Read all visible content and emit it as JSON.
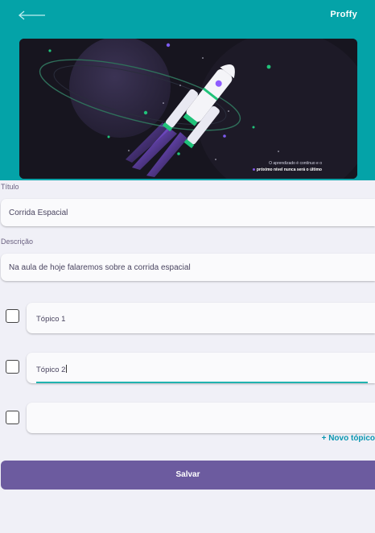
{
  "header": {
    "brand": "Proffy"
  },
  "banner": {
    "caption_line1": "O aprendizado é contínuo e o",
    "caption_line2": "próximo nível nunca será o último",
    "rocket_text": "proffy"
  },
  "form": {
    "title_label": "Título",
    "title_value": "Corrida Espacial",
    "description_label": "Descrição",
    "description_value": "Na aula de hoje falaremos sobre a corrida espacial",
    "topics": [
      {
        "value": "Tópico 1",
        "checked": false
      },
      {
        "value": "Tópico 2",
        "checked": false
      },
      {
        "value": "",
        "checked": false
      }
    ],
    "new_topic_label": "+ Novo tópico",
    "save_label": "Salvar"
  },
  "colors": {
    "header": "#04a3a8",
    "accent": "#6c5b9f",
    "link": "#0a96b0"
  }
}
